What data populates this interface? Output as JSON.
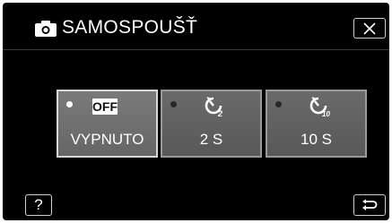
{
  "header": {
    "title": "SAMOSPOUŠŤ",
    "mode_icon": "camera-icon",
    "close_icon": "close-icon"
  },
  "options": [
    {
      "label": "VYPNUTO",
      "icon": "off-badge-icon",
      "badge": "OFF",
      "selected": true
    },
    {
      "label": "2 S",
      "icon": "timer-2s-icon",
      "selected": false
    },
    {
      "label": "10 S",
      "icon": "timer-10s-icon",
      "selected": false
    }
  ],
  "footer": {
    "help_label": "?",
    "back_icon": "return-icon"
  },
  "colors": {
    "background": "#000000",
    "button_fill": "#666666",
    "selected_border": "#d8d8d8"
  }
}
